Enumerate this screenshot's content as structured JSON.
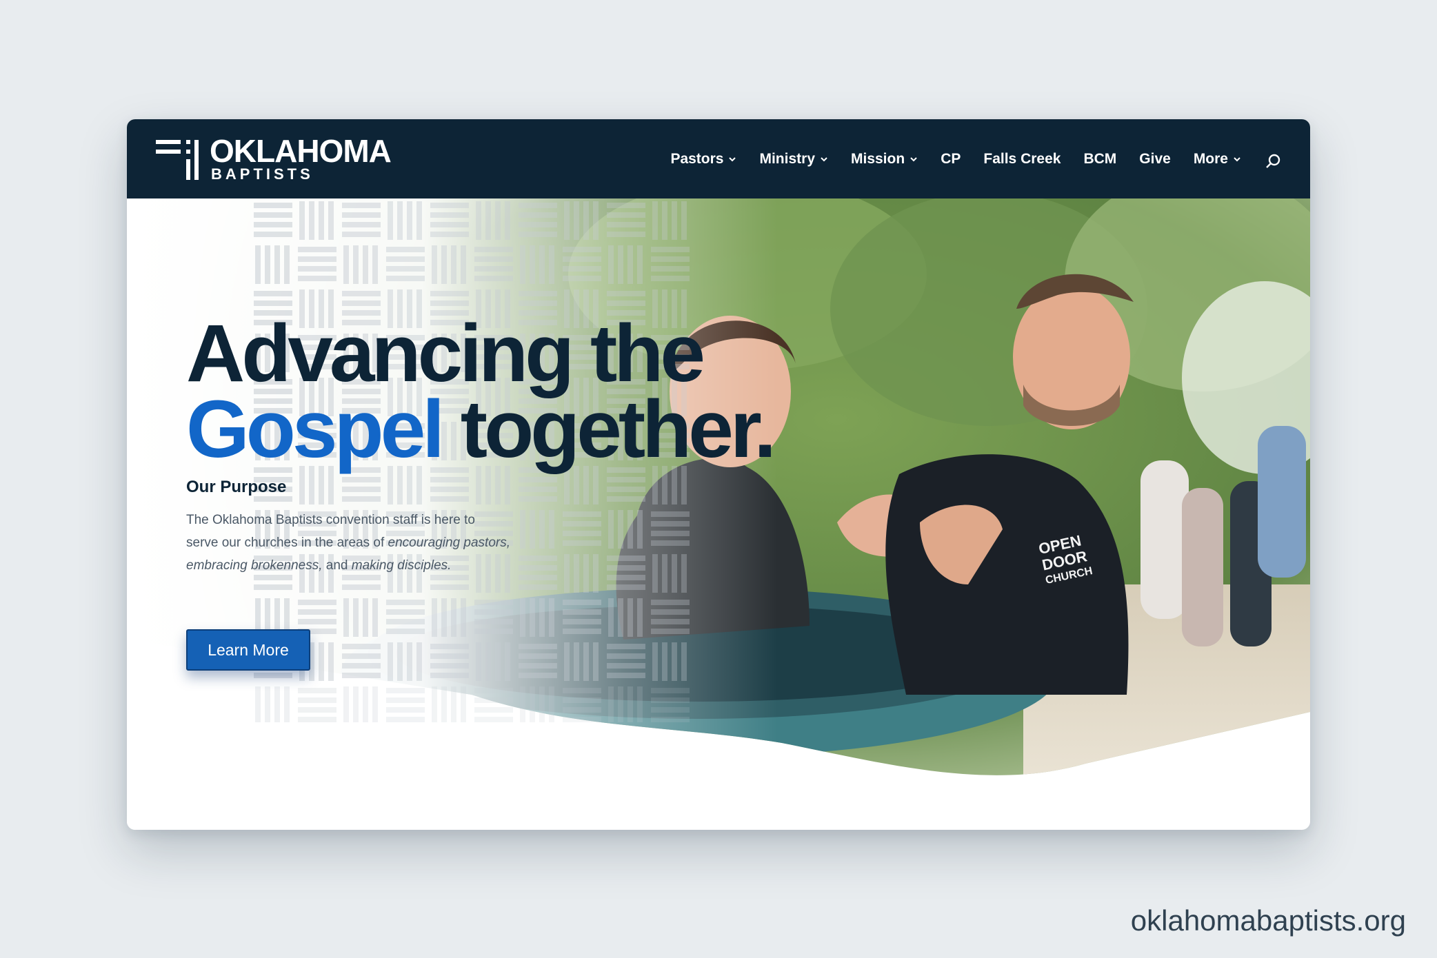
{
  "brand": {
    "logo_title": "OKLAHOMA",
    "logo_subtitle": "BAPTISTS"
  },
  "nav": {
    "items": [
      {
        "label": "Pastors",
        "dropdown": true
      },
      {
        "label": "Ministry",
        "dropdown": true
      },
      {
        "label": "Mission",
        "dropdown": true
      },
      {
        "label": "CP",
        "dropdown": false
      },
      {
        "label": "Falls Creek",
        "dropdown": false
      },
      {
        "label": "BCM",
        "dropdown": false
      },
      {
        "label": "Give",
        "dropdown": false
      },
      {
        "label": "More",
        "dropdown": true
      }
    ],
    "search_icon": "search-icon"
  },
  "hero": {
    "headline_line1": "Advancing the",
    "headline_highlight": "Gospel",
    "headline_line2_rest": " together.",
    "purpose_title": "Our Purpose",
    "purpose_text_1": "The Oklahoma Baptists convention staff is here to serve our churches in the areas of ",
    "purpose_em_1": "encouraging pastors, embracing brokenness,",
    "purpose_text_2": " and ",
    "purpose_em_2": "making disciples.",
    "button_label": "Learn More",
    "shirt_text": "OPEN DOOR CHURCH"
  },
  "footer_domain": "oklahomabaptists.org",
  "colors": {
    "navy": "#0d2436",
    "accent_blue": "#1266c8",
    "button_blue": "#1561b5",
    "background": "#e8ecef"
  }
}
